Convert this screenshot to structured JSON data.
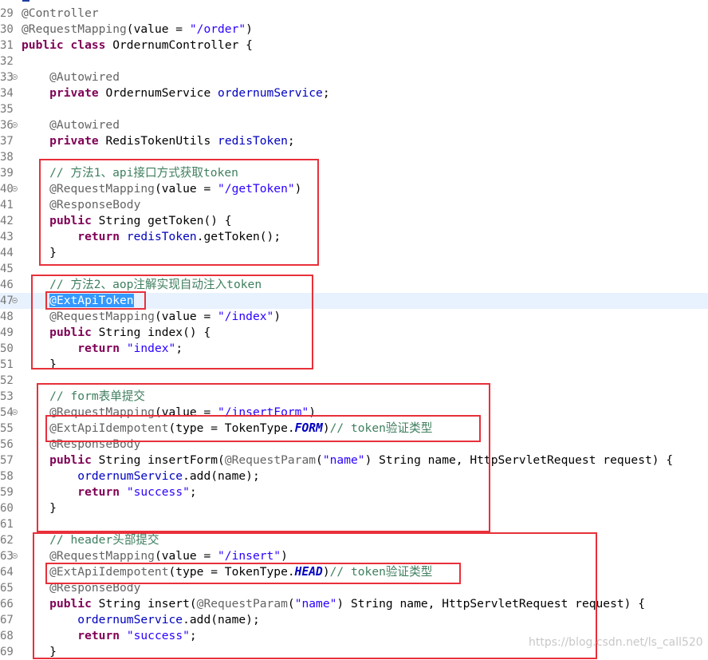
{
  "lines": [
    {
      "num": "29",
      "tokens": [
        {
          "t": "@Controller",
          "c": "ann"
        }
      ]
    },
    {
      "num": "30",
      "tokens": [
        {
          "t": "@RequestMapping",
          "c": "ann"
        },
        {
          "t": "(value = ",
          "c": "pl"
        },
        {
          "t": "\"/order\"",
          "c": "str"
        },
        {
          "t": ")",
          "c": "pl"
        }
      ]
    },
    {
      "num": "31",
      "tokens": [
        {
          "t": "public",
          "c": "kw"
        },
        {
          "t": " ",
          "c": "pl"
        },
        {
          "t": "class",
          "c": "kw"
        },
        {
          "t": " OrdernumController {",
          "c": "pl"
        }
      ]
    },
    {
      "num": "32",
      "tokens": []
    },
    {
      "num": "33",
      "fold": true,
      "tokens": [
        {
          "t": "    @Autowired",
          "c": "ann"
        }
      ]
    },
    {
      "num": "34",
      "tokens": [
        {
          "t": "    ",
          "c": "pl"
        },
        {
          "t": "private",
          "c": "kw"
        },
        {
          "t": " OrdernumService ",
          "c": "pl"
        },
        {
          "t": "ordernumService",
          "c": "fld"
        },
        {
          "t": ";",
          "c": "pl"
        }
      ]
    },
    {
      "num": "35",
      "tokens": []
    },
    {
      "num": "36",
      "fold": true,
      "tokens": [
        {
          "t": "    @Autowired",
          "c": "ann"
        }
      ]
    },
    {
      "num": "37",
      "tokens": [
        {
          "t": "    ",
          "c": "pl"
        },
        {
          "t": "private",
          "c": "kw"
        },
        {
          "t": " RedisTokenUtils ",
          "c": "pl"
        },
        {
          "t": "redisToken",
          "c": "fld"
        },
        {
          "t": ";",
          "c": "pl"
        }
      ]
    },
    {
      "num": "38",
      "tokens": []
    },
    {
      "num": "39",
      "tokens": [
        {
          "t": "    // 方法1、api接口方式获取token",
          "c": "cmt"
        }
      ]
    },
    {
      "num": "40",
      "fold": true,
      "tokens": [
        {
          "t": "    @RequestMapping",
          "c": "ann"
        },
        {
          "t": "(value = ",
          "c": "pl"
        },
        {
          "t": "\"/getToken\"",
          "c": "str"
        },
        {
          "t": ")",
          "c": "pl"
        }
      ]
    },
    {
      "num": "41",
      "tokens": [
        {
          "t": "    @ResponseBody",
          "c": "ann"
        }
      ]
    },
    {
      "num": "42",
      "tokens": [
        {
          "t": "    ",
          "c": "pl"
        },
        {
          "t": "public",
          "c": "kw"
        },
        {
          "t": " String getToken() {",
          "c": "pl"
        }
      ]
    },
    {
      "num": "43",
      "tokens": [
        {
          "t": "        ",
          "c": "pl"
        },
        {
          "t": "return",
          "c": "kw"
        },
        {
          "t": " ",
          "c": "pl"
        },
        {
          "t": "redisToken",
          "c": "fld"
        },
        {
          "t": ".getToken();",
          "c": "pl"
        }
      ]
    },
    {
      "num": "44",
      "tokens": [
        {
          "t": "    }",
          "c": "pl"
        }
      ]
    },
    {
      "num": "45",
      "tokens": []
    },
    {
      "num": "46",
      "tokens": [
        {
          "t": "    // 方法2、aop注解实现自动注入token",
          "c": "cmt"
        }
      ]
    },
    {
      "num": "47",
      "fold": true,
      "current": true,
      "tokens": [
        {
          "t": "    ",
          "c": "pl"
        },
        {
          "t": "@ExtApiToken",
          "c": "sel"
        }
      ]
    },
    {
      "num": "48",
      "tokens": [
        {
          "t": "    @RequestMapping",
          "c": "ann"
        },
        {
          "t": "(value = ",
          "c": "pl"
        },
        {
          "t": "\"/index\"",
          "c": "str"
        },
        {
          "t": ")",
          "c": "pl"
        }
      ]
    },
    {
      "num": "49",
      "tokens": [
        {
          "t": "    ",
          "c": "pl"
        },
        {
          "t": "public",
          "c": "kw"
        },
        {
          "t": " String index() {",
          "c": "pl"
        }
      ]
    },
    {
      "num": "50",
      "tokens": [
        {
          "t": "        ",
          "c": "pl"
        },
        {
          "t": "return",
          "c": "kw"
        },
        {
          "t": " ",
          "c": "pl"
        },
        {
          "t": "\"index\"",
          "c": "str"
        },
        {
          "t": ";",
          "c": "pl"
        }
      ]
    },
    {
      "num": "51",
      "tokens": [
        {
          "t": "    }",
          "c": "pl"
        }
      ]
    },
    {
      "num": "52",
      "tokens": []
    },
    {
      "num": "53",
      "tokens": [
        {
          "t": "    // form表单提交",
          "c": "cmt"
        }
      ]
    },
    {
      "num": "54",
      "fold": true,
      "tokens": [
        {
          "t": "    @RequestMapping",
          "c": "ann"
        },
        {
          "t": "(value = ",
          "c": "pl"
        },
        {
          "t": "\"/insertForm\"",
          "c": "str"
        },
        {
          "t": ")",
          "c": "pl"
        }
      ]
    },
    {
      "num": "55",
      "tokens": [
        {
          "t": "    @ExtApiIdempotent",
          "c": "ann"
        },
        {
          "t": "(type = TokenType.",
          "c": "pl"
        },
        {
          "t": "FORM",
          "c": "cst"
        },
        {
          "t": ")",
          "c": "pl"
        },
        {
          "t": "// token验证类型",
          "c": "cmt"
        }
      ]
    },
    {
      "num": "56",
      "tokens": [
        {
          "t": "    @ResponseBody",
          "c": "ann"
        }
      ]
    },
    {
      "num": "57",
      "tokens": [
        {
          "t": "    ",
          "c": "pl"
        },
        {
          "t": "public",
          "c": "kw"
        },
        {
          "t": " String insertForm(",
          "c": "pl"
        },
        {
          "t": "@RequestParam",
          "c": "ann"
        },
        {
          "t": "(",
          "c": "pl"
        },
        {
          "t": "\"name\"",
          "c": "str"
        },
        {
          "t": ") String name, HttpServletRequest request) {",
          "c": "pl"
        }
      ]
    },
    {
      "num": "58",
      "tokens": [
        {
          "t": "        ",
          "c": "pl"
        },
        {
          "t": "ordernumService",
          "c": "fld"
        },
        {
          "t": ".add(name);",
          "c": "pl"
        }
      ]
    },
    {
      "num": "59",
      "tokens": [
        {
          "t": "        ",
          "c": "pl"
        },
        {
          "t": "return",
          "c": "kw"
        },
        {
          "t": " ",
          "c": "pl"
        },
        {
          "t": "\"success\"",
          "c": "str"
        },
        {
          "t": ";",
          "c": "pl"
        }
      ]
    },
    {
      "num": "60",
      "tokens": [
        {
          "t": "    }",
          "c": "pl"
        }
      ]
    },
    {
      "num": "61",
      "tokens": []
    },
    {
      "num": "62",
      "tokens": [
        {
          "t": "    // header头部提交",
          "c": "cmt"
        }
      ]
    },
    {
      "num": "63",
      "fold": true,
      "tokens": [
        {
          "t": "    @RequestMapping",
          "c": "ann"
        },
        {
          "t": "(value = ",
          "c": "pl"
        },
        {
          "t": "\"/insert\"",
          "c": "str"
        },
        {
          "t": ")",
          "c": "pl"
        }
      ]
    },
    {
      "num": "64",
      "tokens": [
        {
          "t": "    @ExtApiIdempotent",
          "c": "ann"
        },
        {
          "t": "(type = TokenType.",
          "c": "pl"
        },
        {
          "t": "HEAD",
          "c": "cst"
        },
        {
          "t": ")",
          "c": "pl"
        },
        {
          "t": "// token验证类型",
          "c": "cmt"
        }
      ]
    },
    {
      "num": "65",
      "tokens": [
        {
          "t": "    @ResponseBody",
          "c": "ann"
        }
      ]
    },
    {
      "num": "66",
      "tokens": [
        {
          "t": "    ",
          "c": "pl"
        },
        {
          "t": "public",
          "c": "kw"
        },
        {
          "t": " String insert(",
          "c": "pl"
        },
        {
          "t": "@RequestParam",
          "c": "ann"
        },
        {
          "t": "(",
          "c": "pl"
        },
        {
          "t": "\"name\"",
          "c": "str"
        },
        {
          "t": ") String name, HttpServletRequest request) {",
          "c": "pl"
        }
      ]
    },
    {
      "num": "67",
      "tokens": [
        {
          "t": "        ",
          "c": "pl"
        },
        {
          "t": "ordernumService",
          "c": "fld"
        },
        {
          "t": ".add(name);",
          "c": "pl"
        }
      ]
    },
    {
      "num": "68",
      "tokens": [
        {
          "t": "        ",
          "c": "pl"
        },
        {
          "t": "return",
          "c": "kw"
        },
        {
          "t": " ",
          "c": "pl"
        },
        {
          "t": "\"success\"",
          "c": "str"
        },
        {
          "t": ";",
          "c": "pl"
        }
      ]
    },
    {
      "num": "69",
      "tokens": [
        {
          "t": "    }",
          "c": "pl"
        }
      ]
    }
  ],
  "watermark": "https://blog.csdn.net/ls_call520",
  "colors": {
    "keyword": "#7f0055",
    "annotation": "#646464",
    "string": "#2a00ff",
    "comment": "#3f7f5f",
    "field": "#0000c0",
    "highlight_box": "#e8303a",
    "current_line": "#e8f2fe",
    "selection": "#3399ff"
  }
}
